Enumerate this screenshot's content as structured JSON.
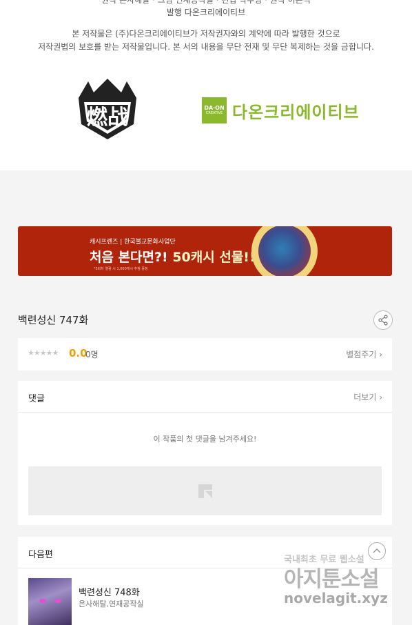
{
  "credits": {
    "cut_line": "원작 은사해탈 · 그림 연재공작실 · 편집 박주영 · 원작 이은석",
    "publisher_line": "발행 다온크리에이티브",
    "copyright_line1": "본 저작물은 (주)다온크리에이티브가 저작권자와의 계약에 따라 발행한 것으로",
    "copyright_line2": "저작권법의 보호를 받는 저작물입니다. 본 서의 내용을 무단 전재 및 무단 복제하는 것을 금합니다.",
    "logo_left_text": "燃战",
    "logo_right_box": "DA·ON",
    "logo_right_box_sub": "CREATIVE",
    "logo_right_name": "다온크리에이티브",
    "brand_green": "#8ab92d"
  },
  "banner": {
    "top_text": "캐시프렌즈 | 한국불교문화사업단",
    "main_text_a": "처음 본다면?!",
    "main_text_b": "50캐시 선물!!",
    "note": "*5화차 열람 시 1,000캐시 추첨 증정",
    "bg_color": "#b0240b"
  },
  "episode": {
    "title": "백련성신 747화"
  },
  "rating": {
    "stars": "★★★★★",
    "value": "0.0",
    "count": "0명",
    "rate_link": "별점주기 ›"
  },
  "comments": {
    "title": "댓글",
    "more": "더보기 ›",
    "empty_message": "이 작품의 첫 댓글을 남겨주세요!"
  },
  "next": {
    "section_title": "다음편",
    "title": "백련성신 748화",
    "author": "은사해탈,연재공작실"
  },
  "watermark": {
    "top": "국내최초 무료 웹소설",
    "big": "아지툰소설",
    "url": "novelagit.xyz"
  }
}
